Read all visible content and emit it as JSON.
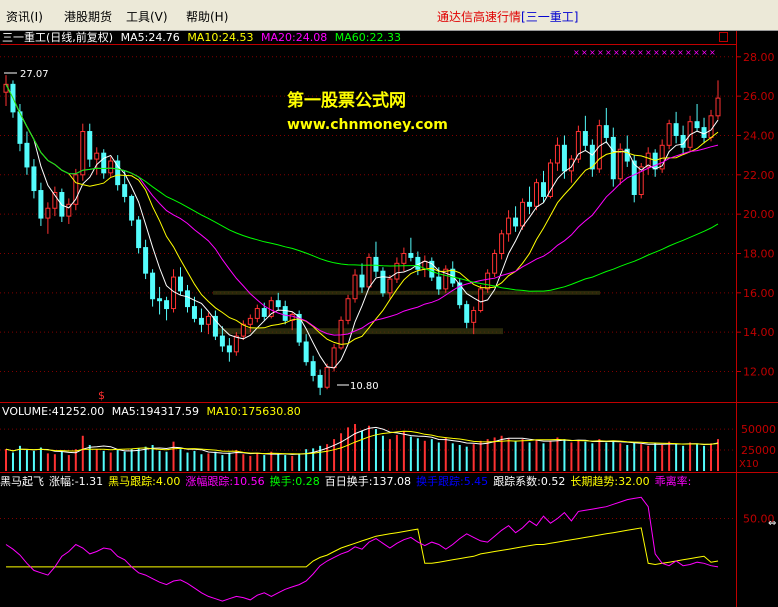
{
  "menu": {
    "items": [
      "资讯(I)",
      "港股期货",
      "工具(V)",
      "帮助(H)"
    ],
    "brand_title": "通达信高速行情",
    "brand_stock": "[三一重工]"
  },
  "colors": {
    "up": "#ff3232",
    "down": "#54fcfc",
    "ma5": "#ffffff",
    "ma10": "#ffff00",
    "ma20": "#ff00ff",
    "ma60": "#00ff00",
    "grid": "#800000",
    "axis": "#c00000"
  },
  "price_panel": {
    "header": {
      "name": "三一重工(日线,前复权)",
      "ma5": "MA5:24.76",
      "ma10": "MA10:24.53",
      "ma20": "MA20:24.08",
      "ma60": "MA60:22.33"
    },
    "y_ticks": [
      "28.00",
      "26.00",
      "24.00",
      "22.00",
      "20.00",
      "18.00",
      "16.00",
      "14.00",
      "12.00"
    ],
    "high_label": "27.07",
    "low_label": "10.80",
    "signal_mark": "$",
    "watermark_title": "第一股票公式网",
    "watermark_url": "www.chnmoney.com",
    "corner_icon": "square-icon"
  },
  "volume_panel": {
    "header": {
      "volume": "VOLUME:41252.00",
      "ma5": "MA5:194317.59",
      "ma10": "MA10:175630.80"
    },
    "y_ticks": [
      "50000",
      "25000"
    ],
    "unit": "X10"
  },
  "indicator_panel": {
    "header": [
      {
        "text": "黑马起飞",
        "color": "#ffffff"
      },
      {
        "text": "涨幅:-1.31",
        "color": "#ffffff"
      },
      {
        "text": "黑马跟踪:4.00",
        "color": "#ffff00"
      },
      {
        "text": "涨幅跟踪:10.56",
        "color": "#ff00ff"
      },
      {
        "text": "换手:0.28",
        "color": "#00ff00"
      },
      {
        "text": "百日换手:137.08",
        "color": "#ffffff"
      },
      {
        "text": "换手跟踪:5.45",
        "color": "#0000ff"
      },
      {
        "text": "跟踪系数:0.52",
        "color": "#ffffff"
      },
      {
        "text": "长期趋势:32.00",
        "color": "#ffff00"
      },
      {
        "text": "乖离率:",
        "color": "#ff00ff"
      }
    ],
    "y_ticks": [
      "50.00"
    ]
  },
  "chart_data": {
    "type": "candlestick",
    "title": "三一重工(日线,前复权)",
    "ylim": [
      10.5,
      28.6
    ],
    "candles": [
      [
        26.2,
        27.07,
        25.5,
        26.6
      ],
      [
        26.6,
        26.8,
        24.9,
        25.2
      ],
      [
        25.2,
        25.6,
        23.2,
        23.6
      ],
      [
        23.6,
        24.2,
        22.0,
        22.4
      ],
      [
        22.4,
        22.8,
        20.8,
        21.2
      ],
      [
        21.2,
        21.6,
        19.4,
        19.8
      ],
      [
        19.8,
        20.6,
        19.0,
        20.3
      ],
      [
        20.3,
        21.4,
        19.9,
        21.1
      ],
      [
        21.1,
        21.3,
        19.6,
        19.9
      ],
      [
        19.9,
        20.8,
        19.5,
        20.5
      ],
      [
        20.5,
        22.3,
        20.2,
        22.0
      ],
      [
        22.0,
        24.6,
        21.7,
        24.2
      ],
      [
        24.2,
        24.6,
        22.4,
        22.8
      ],
      [
        22.8,
        23.4,
        22.0,
        23.1
      ],
      [
        23.1,
        23.3,
        21.8,
        22.1
      ],
      [
        22.1,
        22.9,
        21.9,
        22.7
      ],
      [
        22.7,
        23.0,
        21.2,
        21.5
      ],
      [
        21.5,
        22.2,
        20.6,
        20.9
      ],
      [
        20.9,
        21.0,
        19.4,
        19.7
      ],
      [
        19.7,
        19.9,
        18.0,
        18.3
      ],
      [
        18.3,
        18.7,
        16.7,
        17.0
      ],
      [
        17.0,
        17.2,
        15.3,
        15.7
      ],
      [
        15.7,
        16.3,
        14.9,
        15.6
      ],
      [
        15.6,
        15.8,
        14.6,
        15.2
      ],
      [
        15.2,
        17.2,
        15.0,
        16.8
      ],
      [
        16.8,
        17.3,
        15.9,
        16.1
      ],
      [
        16.1,
        16.4,
        15.0,
        15.3
      ],
      [
        15.3,
        15.8,
        14.5,
        14.7
      ],
      [
        14.7,
        15.2,
        14.0,
        14.4
      ],
      [
        14.4,
        15.0,
        13.9,
        14.8
      ],
      [
        14.8,
        15.1,
        13.6,
        13.8
      ],
      [
        13.8,
        14.3,
        13.0,
        13.3
      ],
      [
        13.3,
        13.7,
        12.5,
        13.0
      ],
      [
        13.0,
        14.0,
        12.8,
        13.8
      ],
      [
        13.8,
        14.6,
        13.6,
        14.4
      ],
      [
        14.4,
        14.9,
        14.0,
        14.7
      ],
      [
        14.7,
        15.4,
        14.5,
        15.2
      ],
      [
        15.2,
        15.5,
        14.6,
        14.8
      ],
      [
        14.8,
        15.8,
        14.7,
        15.6
      ],
      [
        15.6,
        16.0,
        15.1,
        15.3
      ],
      [
        15.3,
        15.6,
        14.4,
        14.6
      ],
      [
        14.6,
        15.0,
        14.1,
        14.9
      ],
      [
        14.9,
        15.1,
        13.3,
        13.5
      ],
      [
        13.5,
        13.9,
        12.3,
        12.5
      ],
      [
        12.5,
        12.8,
        11.5,
        11.8
      ],
      [
        11.8,
        12.1,
        10.8,
        11.2
      ],
      [
        11.2,
        12.4,
        11.1,
        12.2
      ],
      [
        12.2,
        13.4,
        12.0,
        13.2
      ],
      [
        13.2,
        14.8,
        13.1,
        14.6
      ],
      [
        14.6,
        15.9,
        14.4,
        15.7
      ],
      [
        15.7,
        17.2,
        15.5,
        16.9
      ],
      [
        16.9,
        17.5,
        16.0,
        16.3
      ],
      [
        16.3,
        18.0,
        16.2,
        17.8
      ],
      [
        17.8,
        18.6,
        16.8,
        17.1
      ],
      [
        17.1,
        17.3,
        15.8,
        16.0
      ],
      [
        16.0,
        16.9,
        15.7,
        16.7
      ],
      [
        16.7,
        17.8,
        16.5,
        17.5
      ],
      [
        17.5,
        18.3,
        17.1,
        18.0
      ],
      [
        18.0,
        18.8,
        17.6,
        17.8
      ],
      [
        17.8,
        18.1,
        16.9,
        17.2
      ],
      [
        17.2,
        17.9,
        16.8,
        17.6
      ],
      [
        17.6,
        17.8,
        16.6,
        16.8
      ],
      [
        16.8,
        17.3,
        15.9,
        16.2
      ],
      [
        16.2,
        17.4,
        16.0,
        17.2
      ],
      [
        17.2,
        17.6,
        16.3,
        16.5
      ],
      [
        16.5,
        16.7,
        15.2,
        15.4
      ],
      [
        15.4,
        15.6,
        14.2,
        14.5
      ],
      [
        14.5,
        15.3,
        13.9,
        15.1
      ],
      [
        15.1,
        16.4,
        15.0,
        16.2
      ],
      [
        16.2,
        17.2,
        16.0,
        17.0
      ],
      [
        17.0,
        18.2,
        16.8,
        18.0
      ],
      [
        18.0,
        19.2,
        17.7,
        19.0
      ],
      [
        19.0,
        20.2,
        18.6,
        19.8
      ],
      [
        19.8,
        20.4,
        19.1,
        19.4
      ],
      [
        19.4,
        20.8,
        19.2,
        20.6
      ],
      [
        20.6,
        21.4,
        20.0,
        20.4
      ],
      [
        20.4,
        21.8,
        20.2,
        21.6
      ],
      [
        21.6,
        22.2,
        20.6,
        20.9
      ],
      [
        20.9,
        22.8,
        20.8,
        22.6
      ],
      [
        22.6,
        23.9,
        22.2,
        23.5
      ],
      [
        23.5,
        24.0,
        21.8,
        22.2
      ],
      [
        22.2,
        23.0,
        21.6,
        22.8
      ],
      [
        22.8,
        24.5,
        22.6,
        24.2
      ],
      [
        24.2,
        25.0,
        23.2,
        23.5
      ],
      [
        23.5,
        23.8,
        21.9,
        22.3
      ],
      [
        22.3,
        24.8,
        22.1,
        24.5
      ],
      [
        24.5,
        25.4,
        23.6,
        23.9
      ],
      [
        23.9,
        24.4,
        21.4,
        21.8
      ],
      [
        21.8,
        23.6,
        21.5,
        23.3
      ],
      [
        23.3,
        24.0,
        22.4,
        22.7
      ],
      [
        22.7,
        23.0,
        20.6,
        21.0
      ],
      [
        21.0,
        22.6,
        20.8,
        22.4
      ],
      [
        22.4,
        23.4,
        22.0,
        23.1
      ],
      [
        23.1,
        23.3,
        21.9,
        22.3
      ],
      [
        22.3,
        23.8,
        22.1,
        23.5
      ],
      [
        23.5,
        24.8,
        23.3,
        24.6
      ],
      [
        24.6,
        25.2,
        23.6,
        24.0
      ],
      [
        24.0,
        24.5,
        23.1,
        23.4
      ],
      [
        23.4,
        25.0,
        23.2,
        24.7
      ],
      [
        24.7,
        25.6,
        24.2,
        24.4
      ],
      [
        24.4,
        24.9,
        23.6,
        23.9
      ],
      [
        23.9,
        25.3,
        23.7,
        25.0
      ],
      [
        25.0,
        26.8,
        24.8,
        25.9
      ]
    ],
    "volume": [
      260,
      220,
      300,
      250,
      240,
      280,
      210,
      200,
      230,
      190,
      260,
      420,
      310,
      260,
      240,
      220,
      250,
      230,
      260,
      270,
      290,
      310,
      240,
      230,
      350,
      260,
      220,
      240,
      200,
      210,
      230,
      190,
      220,
      250,
      200,
      180,
      210,
      190,
      230,
      200,
      190,
      180,
      210,
      260,
      270,
      300,
      320,
      380,
      450,
      520,
      560,
      480,
      540,
      500,
      420,
      380,
      430,
      470,
      410,
      390,
      360,
      380,
      340,
      400,
      330,
      310,
      290,
      320,
      360,
      380,
      400,
      420,
      390,
      360,
      380,
      340,
      370,
      330,
      360,
      400,
      380,
      340,
      360,
      350,
      330,
      380,
      340,
      360,
      330,
      310,
      340,
      320,
      300,
      330,
      310,
      350,
      320,
      300,
      340,
      320,
      300,
      330,
      380
    ],
    "indicator": [
      28,
      24,
      19,
      12,
      6,
      4,
      2,
      9,
      18,
      22,
      28,
      25,
      20,
      22,
      25,
      24,
      18,
      15,
      9,
      4,
      2,
      -1,
      -4,
      -6,
      -3,
      -2,
      -5,
      -9,
      -13,
      -16,
      -18,
      -20,
      -18,
      -16,
      -17,
      -19,
      -15,
      -13,
      -16,
      -13,
      -10,
      -8,
      -6,
      -3,
      3,
      10,
      14,
      17,
      20,
      22,
      26,
      24,
      30,
      33,
      29,
      25,
      29,
      32,
      34,
      30,
      27,
      30,
      28,
      24,
      28,
      33,
      37,
      34,
      31,
      30,
      35,
      40,
      44,
      38,
      42,
      48,
      44,
      52,
      46,
      50,
      55,
      48,
      56,
      57,
      58,
      59,
      60,
      62,
      64,
      66,
      67,
      68,
      60,
      20,
      12,
      10,
      14,
      10,
      11,
      13,
      12,
      10,
      9
    ],
    "trend_line": [
      9,
      9,
      9,
      9,
      9,
      9,
      9,
      9,
      9,
      9,
      9,
      9,
      9,
      9,
      9,
      9,
      9,
      9,
      9,
      9,
      9,
      9,
      9,
      9,
      9,
      9,
      9,
      9,
      9,
      9,
      9,
      9,
      9,
      9,
      9,
      9,
      9,
      9,
      9,
      9,
      9,
      9,
      9,
      9,
      14,
      17,
      19,
      22,
      25,
      27,
      29,
      31,
      33,
      35,
      36,
      37,
      38,
      39,
      40,
      41,
      12,
      12,
      13,
      14,
      15,
      16,
      17,
      18,
      20,
      21,
      22,
      23,
      24,
      25,
      26,
      27,
      28,
      28,
      29,
      30,
      31,
      32,
      33,
      34,
      35,
      36,
      37,
      38,
      39,
      40,
      41,
      42,
      12,
      11,
      12,
      13,
      14,
      15,
      16,
      17,
      18,
      13,
      14
    ]
  }
}
